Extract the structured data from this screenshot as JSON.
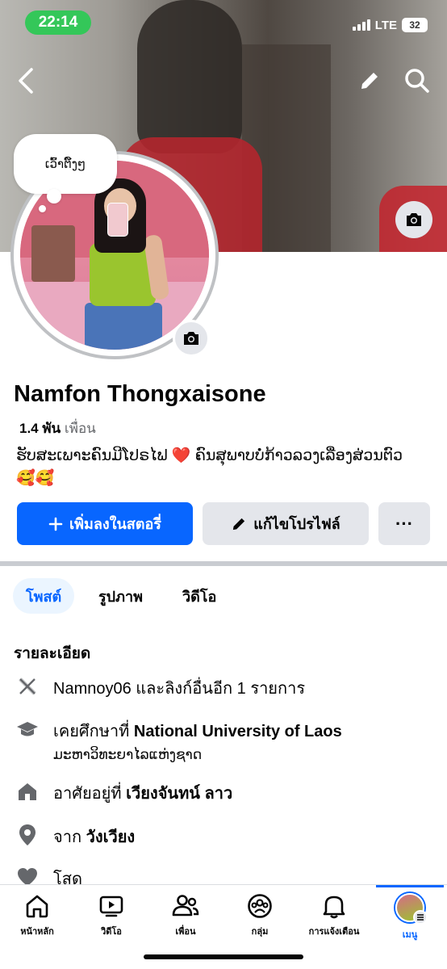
{
  "status_bar": {
    "time": "22:14",
    "network": "LTE",
    "battery": "32"
  },
  "cover": {
    "speech_bubble": "ເວົ້າຕິ໌ງໆ"
  },
  "profile": {
    "name": "Namfon Thongxaisone",
    "friends_count": "1.4 พัน",
    "friends_label": "เพื่อน",
    "bio_text": "ຮັບສະເພາະຄົນມີໂປຣໄຟ",
    "bio_heart": "❤️",
    "bio_text2": "ຄົນສຸພາບບໍ່ກ້າວລວງເລື່ອງສ່ວນຕົວ",
    "bio_emoji": "🥰🥰"
  },
  "actions": {
    "add_story": "เพิ่มลงในสตอรี่",
    "edit_profile": "แก้ไขโปรไฟล์",
    "more": "···"
  },
  "tabs": [
    {
      "label": "โพสต์",
      "active": true
    },
    {
      "label": "รูปภาพ",
      "active": false
    },
    {
      "label": "วิดีโอ",
      "active": false
    }
  ],
  "details": {
    "title": "รายละเอียด",
    "x_link": "Namnoy06 และลิงก์อื่นอีก 1 รายการ",
    "studied_prefix": "เคยศึกษาที่",
    "studied_school": "National University of Laos",
    "studied_sub": "ມະຫາວິທະຍາໄລແຫ່ງຊາດ",
    "lives_prefix": "อาศัยอยู่ที่",
    "lives_place": "เวียงจันทน์ ลาว",
    "from_prefix": "จาก",
    "from_place": "วังเวียง",
    "relationship": "โสด"
  },
  "bottom_nav": [
    {
      "label": "หน้าหลัก",
      "icon": "home-icon"
    },
    {
      "label": "วิดีโอ",
      "icon": "video-icon"
    },
    {
      "label": "เพื่อน",
      "icon": "friends-icon"
    },
    {
      "label": "กลุ่ม",
      "icon": "groups-icon"
    },
    {
      "label": "การแจ้งเตือน",
      "icon": "bell-icon"
    },
    {
      "label": "เมนู",
      "icon": "menu-avatar",
      "active": true
    }
  ],
  "colors": {
    "primary": "#0866ff",
    "secondary_button": "#e4e6eb",
    "status_pill": "#34c759"
  }
}
